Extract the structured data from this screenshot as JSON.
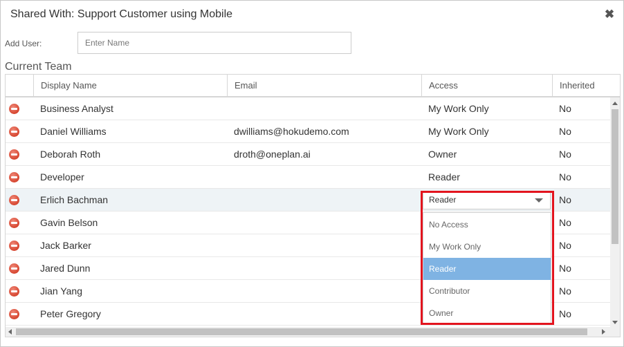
{
  "dialog": {
    "title": "Shared With: Support Customer using Mobile",
    "close_glyph": "✖"
  },
  "add_user": {
    "label": "Add User:",
    "placeholder": "Enter Name",
    "value": ""
  },
  "section_title": "Current Team",
  "grid": {
    "columns": [
      "",
      "Display Name",
      "Email",
      "Access",
      "Inherited"
    ],
    "rows": [
      {
        "name": "Business Analyst",
        "email": "",
        "access": "My Work Only",
        "inherited": "No"
      },
      {
        "name": "Daniel Williams",
        "email": "dwilliams@hokudemo.com",
        "access": "My Work Only",
        "inherited": "No"
      },
      {
        "name": "Deborah Roth",
        "email": "droth@oneplan.ai",
        "access": "Owner",
        "inherited": "No"
      },
      {
        "name": "Developer",
        "email": "",
        "access": "Reader",
        "inherited": "No"
      },
      {
        "name": "Erlich Bachman",
        "email": "",
        "access": "Reader",
        "inherited": "No"
      },
      {
        "name": "Gavin Belson",
        "email": "",
        "access": "",
        "inherited": "No"
      },
      {
        "name": "Jack Barker",
        "email": "",
        "access": "",
        "inherited": "No"
      },
      {
        "name": "Jared Dunn",
        "email": "",
        "access": "",
        "inherited": "No"
      },
      {
        "name": "Jian Yang",
        "email": "",
        "access": "",
        "inherited": "No"
      },
      {
        "name": "Peter Gregory",
        "email": "",
        "access": "",
        "inherited": "No"
      }
    ],
    "editing_row_index": 4
  },
  "access_dropdown": {
    "selected": "Reader",
    "options": [
      "No Access",
      "My Work Only",
      "Reader",
      "Contributor",
      "Owner"
    ]
  },
  "colors": {
    "remove_icon": "#d6452f",
    "selected_option": "#7fb3e3",
    "highlight_box": "#e3141e",
    "selected_row": "#eef3f6"
  },
  "icons": {
    "remove": "remove-circle-icon",
    "close": "close-icon",
    "dropdown": "chevron-down-icon"
  }
}
